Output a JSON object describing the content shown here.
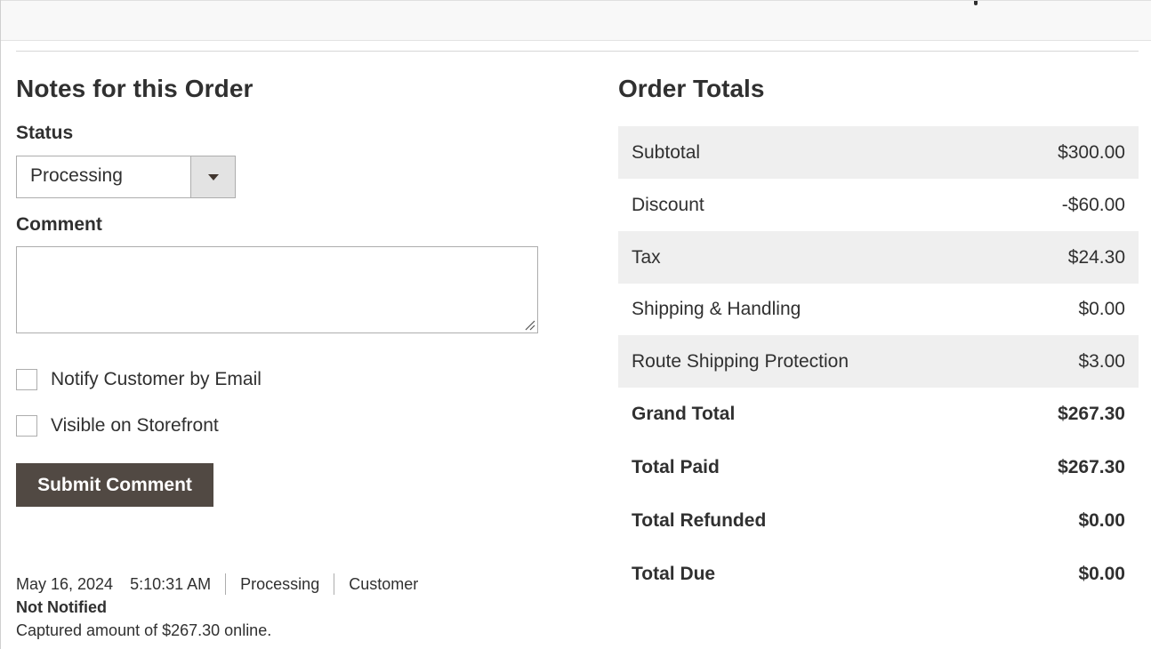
{
  "notes": {
    "title": "Notes for this Order",
    "status_label": "Status",
    "status_value": "Processing",
    "comment_label": "Comment",
    "comment_value": "",
    "notify_label": "Notify Customer by Email",
    "visible_label": "Visible on Storefront",
    "submit_label": "Submit Comment"
  },
  "history": {
    "date": "May 16, 2024",
    "time": "5:10:31 AM",
    "status": "Processing",
    "customer_prefix": "Customer",
    "notified": "Not Notified",
    "comment": "Captured amount of $267.30 online."
  },
  "totals": {
    "title": "Order Totals",
    "rows": [
      {
        "label": "Subtotal",
        "value": "$300.00"
      },
      {
        "label": "Discount",
        "value": "-$60.00"
      },
      {
        "label": "Tax",
        "value": "$24.30"
      },
      {
        "label": "Shipping & Handling",
        "value": "$0.00"
      },
      {
        "label": "Route Shipping Protection",
        "value": "$3.00"
      }
    ],
    "summary": [
      {
        "label": "Grand Total",
        "value": "$267.30"
      },
      {
        "label": "Total Paid",
        "value": "$267.30"
      },
      {
        "label": "Total Refunded",
        "value": "$0.00"
      },
      {
        "label": "Total Due",
        "value": "$0.00"
      }
    ]
  },
  "colors": {
    "button_bg": "#514943",
    "shaded_row": "#efefef",
    "text": "#303030"
  },
  "icons": {
    "select_caret": "caret-down-icon",
    "textarea_grip": "resize-grip-icon"
  }
}
